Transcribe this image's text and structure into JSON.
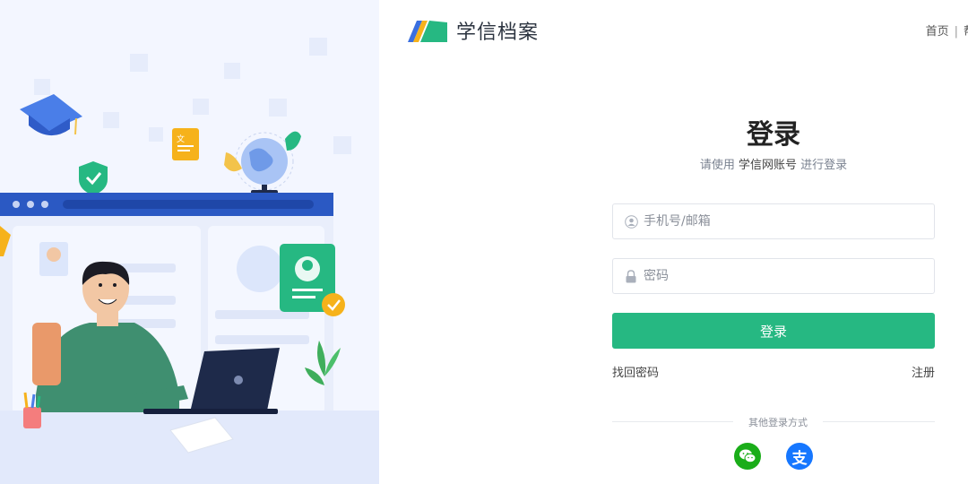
{
  "brand": {
    "name": "学信档案"
  },
  "topnav": {
    "home": "首页",
    "separator": "|",
    "help": "帮"
  },
  "login": {
    "title": "登录",
    "subtitle_prefix": "请使用",
    "subtitle_account": "学信网账号",
    "subtitle_suffix": "进行登录",
    "account_placeholder": "手机号/邮箱",
    "password_placeholder": "密码",
    "submit_label": "登录",
    "forgot_label": "找回密码",
    "register_label": "注册",
    "other_methods_label": "其他登录方式"
  },
  "social": [
    {
      "name": "wechat-icon",
      "color": "#1aad19"
    },
    {
      "name": "alipay-icon",
      "color": "#1677ff",
      "glyph": "支"
    }
  ],
  "colors": {
    "accent": "#26b882",
    "illustration_bg": "#f3f6ff",
    "browser_bar": "#2b59c3"
  }
}
